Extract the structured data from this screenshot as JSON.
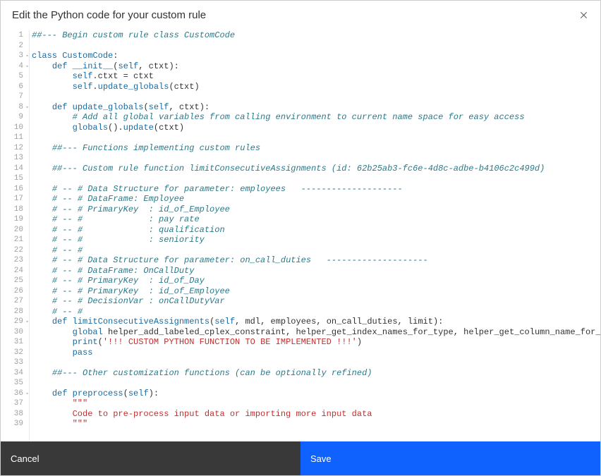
{
  "header": {
    "title": "Edit the Python code for your custom rule"
  },
  "footer": {
    "cancel": "Cancel",
    "save": "Save"
  },
  "code": {
    "lines": [
      {
        "n": 1,
        "fold": false,
        "tokens": [
          [
            "comment",
            "##--- Begin custom rule class CustomCode"
          ]
        ]
      },
      {
        "n": 2,
        "fold": false,
        "tokens": []
      },
      {
        "n": 3,
        "fold": true,
        "tokens": [
          [
            "keyword",
            "class"
          ],
          [
            "default",
            " "
          ],
          [
            "funcname",
            "CustomCode"
          ],
          [
            "punct",
            ":"
          ]
        ]
      },
      {
        "n": 4,
        "fold": true,
        "tokens": [
          [
            "default",
            "    "
          ],
          [
            "keyword",
            "def"
          ],
          [
            "default",
            " "
          ],
          [
            "funcname",
            "__init__"
          ],
          [
            "punct",
            "("
          ],
          [
            "self",
            "self"
          ],
          [
            "punct",
            ", "
          ],
          [
            "default",
            "ctxt"
          ],
          [
            "punct",
            "):"
          ]
        ]
      },
      {
        "n": 5,
        "fold": false,
        "tokens": [
          [
            "default",
            "        "
          ],
          [
            "self",
            "self"
          ],
          [
            "punct",
            "."
          ],
          [
            "default",
            "ctxt "
          ],
          [
            "punct",
            "="
          ],
          [
            "default",
            " ctxt"
          ]
        ]
      },
      {
        "n": 6,
        "fold": false,
        "tokens": [
          [
            "default",
            "        "
          ],
          [
            "self",
            "self"
          ],
          [
            "punct",
            "."
          ],
          [
            "funcname",
            "update_globals"
          ],
          [
            "punct",
            "("
          ],
          [
            "default",
            "ctxt"
          ],
          [
            "punct",
            ")"
          ]
        ]
      },
      {
        "n": 7,
        "fold": false,
        "tokens": []
      },
      {
        "n": 8,
        "fold": true,
        "tokens": [
          [
            "default",
            "    "
          ],
          [
            "keyword",
            "def"
          ],
          [
            "default",
            " "
          ],
          [
            "funcname",
            "update_globals"
          ],
          [
            "punct",
            "("
          ],
          [
            "self",
            "self"
          ],
          [
            "punct",
            ", "
          ],
          [
            "default",
            "ctxt"
          ],
          [
            "punct",
            "):"
          ]
        ]
      },
      {
        "n": 9,
        "fold": false,
        "tokens": [
          [
            "default",
            "        "
          ],
          [
            "comment",
            "# Add all global variables from calling environment to current name space for easy access"
          ]
        ]
      },
      {
        "n": 10,
        "fold": false,
        "tokens": [
          [
            "default",
            "        "
          ],
          [
            "builtin",
            "globals"
          ],
          [
            "punct",
            "()."
          ],
          [
            "funcname",
            "update"
          ],
          [
            "punct",
            "("
          ],
          [
            "default",
            "ctxt"
          ],
          [
            "punct",
            ")"
          ]
        ]
      },
      {
        "n": 11,
        "fold": false,
        "tokens": []
      },
      {
        "n": 12,
        "fold": false,
        "tokens": [
          [
            "default",
            "    "
          ],
          [
            "comment",
            "##--- Functions implementing custom rules"
          ]
        ]
      },
      {
        "n": 13,
        "fold": false,
        "tokens": []
      },
      {
        "n": 14,
        "fold": false,
        "tokens": [
          [
            "default",
            "    "
          ],
          [
            "comment",
            "##--- Custom rule function limitConsecutiveAssignments (id: 62b25ab3-fc6e-4d8c-adbe-b4106c2c499d)"
          ]
        ]
      },
      {
        "n": 15,
        "fold": false,
        "tokens": []
      },
      {
        "n": 16,
        "fold": false,
        "tokens": [
          [
            "default",
            "    "
          ],
          [
            "comment",
            "# -- # Data Structure for parameter: employees   --------------------"
          ]
        ]
      },
      {
        "n": 17,
        "fold": false,
        "tokens": [
          [
            "default",
            "    "
          ],
          [
            "comment",
            "# -- # DataFrame: Employee"
          ]
        ]
      },
      {
        "n": 18,
        "fold": false,
        "tokens": [
          [
            "default",
            "    "
          ],
          [
            "comment",
            "# -- # PrimaryKey  : id_of_Employee"
          ]
        ]
      },
      {
        "n": 19,
        "fold": false,
        "tokens": [
          [
            "default",
            "    "
          ],
          [
            "comment",
            "# -- #             : pay rate"
          ]
        ]
      },
      {
        "n": 20,
        "fold": false,
        "tokens": [
          [
            "default",
            "    "
          ],
          [
            "comment",
            "# -- #             : qualification"
          ]
        ]
      },
      {
        "n": 21,
        "fold": false,
        "tokens": [
          [
            "default",
            "    "
          ],
          [
            "comment",
            "# -- #             : seniority"
          ]
        ]
      },
      {
        "n": 22,
        "fold": false,
        "tokens": [
          [
            "default",
            "    "
          ],
          [
            "comment",
            "# -- #"
          ]
        ]
      },
      {
        "n": 23,
        "fold": false,
        "tokens": [
          [
            "default",
            "    "
          ],
          [
            "comment",
            "# -- # Data Structure for parameter: on_call_duties   --------------------"
          ]
        ]
      },
      {
        "n": 24,
        "fold": false,
        "tokens": [
          [
            "default",
            "    "
          ],
          [
            "comment",
            "# -- # DataFrame: OnCallDuty"
          ]
        ]
      },
      {
        "n": 25,
        "fold": false,
        "tokens": [
          [
            "default",
            "    "
          ],
          [
            "comment",
            "# -- # PrimaryKey  : id_of_Day"
          ]
        ]
      },
      {
        "n": 26,
        "fold": false,
        "tokens": [
          [
            "default",
            "    "
          ],
          [
            "comment",
            "# -- # PrimaryKey  : id_of_Employee"
          ]
        ]
      },
      {
        "n": 27,
        "fold": false,
        "tokens": [
          [
            "default",
            "    "
          ],
          [
            "comment",
            "# -- # DecisionVar : onCallDutyVar"
          ]
        ]
      },
      {
        "n": 28,
        "fold": false,
        "tokens": [
          [
            "default",
            "    "
          ],
          [
            "comment",
            "# -- #"
          ]
        ]
      },
      {
        "n": 29,
        "fold": true,
        "tokens": [
          [
            "default",
            "    "
          ],
          [
            "keyword",
            "def"
          ],
          [
            "default",
            " "
          ],
          [
            "funcname",
            "limitConsecutiveAssignments"
          ],
          [
            "punct",
            "("
          ],
          [
            "self",
            "self"
          ],
          [
            "punct",
            ", "
          ],
          [
            "default",
            "mdl"
          ],
          [
            "punct",
            ", "
          ],
          [
            "default",
            "employees"
          ],
          [
            "punct",
            ", "
          ],
          [
            "default",
            "on_call_duties"
          ],
          [
            "punct",
            ", "
          ],
          [
            "default",
            "limit"
          ],
          [
            "punct",
            "):"
          ]
        ]
      },
      {
        "n": 30,
        "fold": false,
        "tokens": [
          [
            "default",
            "        "
          ],
          [
            "keyword",
            "global"
          ],
          [
            "default",
            " helper_add_labeled_cplex_constraint"
          ],
          [
            "punct",
            ", "
          ],
          [
            "default",
            "helper_get_index_names_for_type"
          ],
          [
            "punct",
            ", "
          ],
          [
            "default",
            "helper_get_column_name_for_property"
          ]
        ]
      },
      {
        "n": 31,
        "fold": false,
        "tokens": [
          [
            "default",
            "        "
          ],
          [
            "builtin",
            "print"
          ],
          [
            "punct",
            "("
          ],
          [
            "string",
            "'!!! CUSTOM PYTHON FUNCTION TO BE IMPLEMENTED !!!'"
          ],
          [
            "punct",
            ")"
          ]
        ]
      },
      {
        "n": 32,
        "fold": false,
        "tokens": [
          [
            "default",
            "        "
          ],
          [
            "keyword",
            "pass"
          ]
        ]
      },
      {
        "n": 33,
        "fold": false,
        "tokens": []
      },
      {
        "n": 34,
        "fold": false,
        "tokens": [
          [
            "default",
            "    "
          ],
          [
            "comment",
            "##--- Other customization functions (can be optionally refined)"
          ]
        ]
      },
      {
        "n": 35,
        "fold": false,
        "tokens": []
      },
      {
        "n": 36,
        "fold": true,
        "tokens": [
          [
            "default",
            "    "
          ],
          [
            "keyword",
            "def"
          ],
          [
            "default",
            " "
          ],
          [
            "funcname",
            "preprocess"
          ],
          [
            "punct",
            "("
          ],
          [
            "self",
            "self"
          ],
          [
            "punct",
            "):"
          ]
        ]
      },
      {
        "n": 37,
        "fold": false,
        "tokens": [
          [
            "default",
            "        "
          ],
          [
            "string",
            "\"\"\""
          ]
        ]
      },
      {
        "n": 38,
        "fold": false,
        "tokens": [
          [
            "default",
            "        "
          ],
          [
            "string",
            "Code to pre-process input data or importing more input data"
          ]
        ]
      },
      {
        "n": 39,
        "fold": false,
        "tokens": [
          [
            "default",
            "        "
          ],
          [
            "string",
            "\"\"\""
          ]
        ]
      }
    ]
  }
}
